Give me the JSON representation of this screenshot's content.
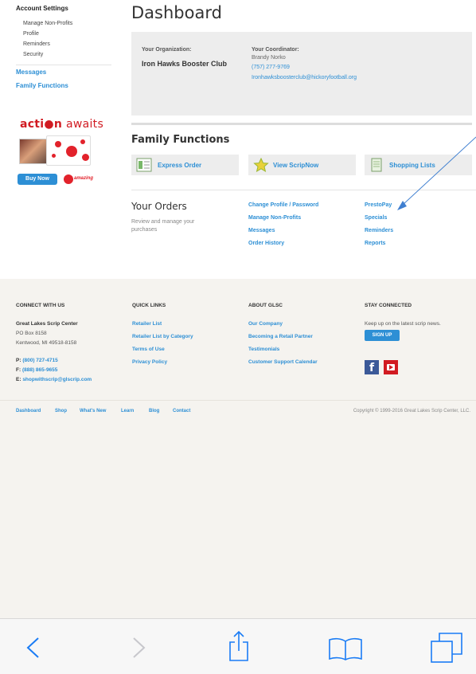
{
  "sidebar": {
    "title": "Account Settings",
    "items": [
      "Manage Non-Profits",
      "Profile",
      "Reminders",
      "Security"
    ],
    "links": [
      "Messages",
      "Family Functions"
    ]
  },
  "ad": {
    "title_bold": "acti",
    "title_o": "o",
    "title_n": "n",
    "title_light": " awaits",
    "buy_label": "Buy Now",
    "amc_label": "amazing"
  },
  "page_title": "Dashboard",
  "info": {
    "org_label": "Your Organization:",
    "org_name": "Iron Hawks Booster Club",
    "coord_label": "Your Coordinator:",
    "coord_name": "Brandy Norko",
    "coord_phone": "(757) 277-9769",
    "coord_email": "Ironhawksboosterclub@hickoryfootball.org"
  },
  "family_functions": {
    "title": "Family Functions",
    "buttons": [
      "Express Order",
      "View ScripNow",
      "Shopping Lists"
    ]
  },
  "orders": {
    "title": "Your Orders",
    "desc": "Review and manage your purchases",
    "col1": [
      "Change Profile / Password",
      "Manage Non-Profits",
      "Messages",
      "Order History"
    ],
    "col2": [
      "PrestoPay",
      "Specials",
      "Reminders",
      "Reports"
    ]
  },
  "footer": {
    "headings": [
      "CONNECT WITH US",
      "QUICK LINKS",
      "ABOUT GLSC",
      "STAY CONNECTED"
    ],
    "org": "Great Lakes Scrip Center",
    "addr1": "PO Box 8158",
    "addr2": "Kentwood, MI 49518-8158",
    "phone_label": "P:",
    "phone": "(800) 727-4715",
    "fax_label": "F:",
    "fax": "(888) 865-9655",
    "email_label": "E:",
    "email": "shopwithscrip@glscrip.com",
    "quick_links": [
      "Retailer List",
      "Retailer List by Category",
      "Terms of Use",
      "Privacy Policy"
    ],
    "about_links": [
      "Our Company",
      "Becoming a Retail Partner",
      "Testimonials",
      "Customer Support Calendar"
    ],
    "stay_text": "Keep up on the latest scrip news.",
    "signup": "SIGN UP",
    "fb": "f",
    "bottom_nav": [
      "Dashboard",
      "Shop",
      "What's New",
      "Learn",
      "Blog",
      "Contact"
    ],
    "copyright": "Copyright © 1999-2016 Great Lakes Scrip Center, LLC."
  },
  "colors": {
    "link": "#2d8fd5",
    "ios_blue": "#1a7cf5",
    "ios_gray": "#c7c7cc",
    "brand_red": "#d11b22"
  },
  "toolbar_icons": [
    "back-icon",
    "forward-icon",
    "share-icon",
    "bookmarks-icon",
    "tabs-icon"
  ]
}
